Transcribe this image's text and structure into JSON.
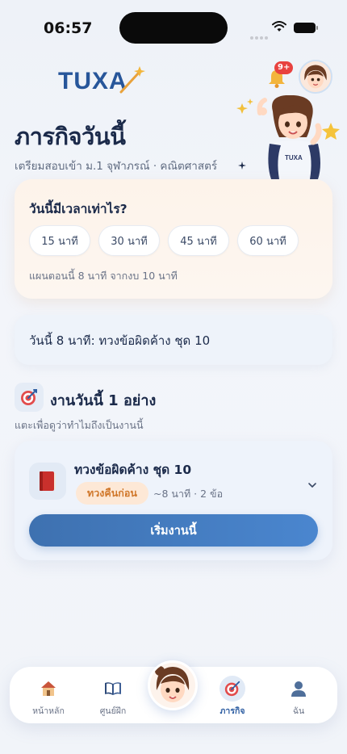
{
  "status_bar": {
    "time": "06:57"
  },
  "header": {
    "logo_text": "TUXA",
    "notification_badge": "9+",
    "title": "ภารกิจวันนี้",
    "subtitle": "เตรียมสอบเข้า ม.1 จุฬาภรณ์ · คณิตศาสตร์"
  },
  "time_card": {
    "question": "วันนี้มีเวลาเท่าไร?",
    "options": [
      "15 นาที",
      "30 นาที",
      "45 นาที",
      "60 นาที"
    ],
    "note": "แผนตอนนี้ 8 นาที จากงบ 10 นาที"
  },
  "plan_banner": {
    "text": "วันนี้ 8 นาที: ทวงข้อผิดค้าง ชุด 10"
  },
  "today": {
    "title": "งานวันนี้ 1 อย่าง",
    "hint": "แตะเพื่อดูว่าทำไมถึงเป็นงานนี้"
  },
  "task": {
    "title": "ทวงข้อผิดค้าง ชุด 10",
    "tag": "ทวงคืนก่อน",
    "meta": "~8 นาที · 2 ข้อ",
    "start_label": "เริ่มงานนี้"
  },
  "nav": {
    "items": [
      {
        "label": "หน้าหลัก",
        "icon": "house-icon"
      },
      {
        "label": "ศูนย์ฝึก",
        "icon": "book-icon"
      },
      {
        "label": "ภารกิจ",
        "icon": "target-icon"
      },
      {
        "label": "ฉัน",
        "icon": "user-icon"
      }
    ]
  },
  "colors": {
    "primary": "#3e71b0",
    "accent_tag": "#d0772a",
    "badge": "#e8423f"
  }
}
